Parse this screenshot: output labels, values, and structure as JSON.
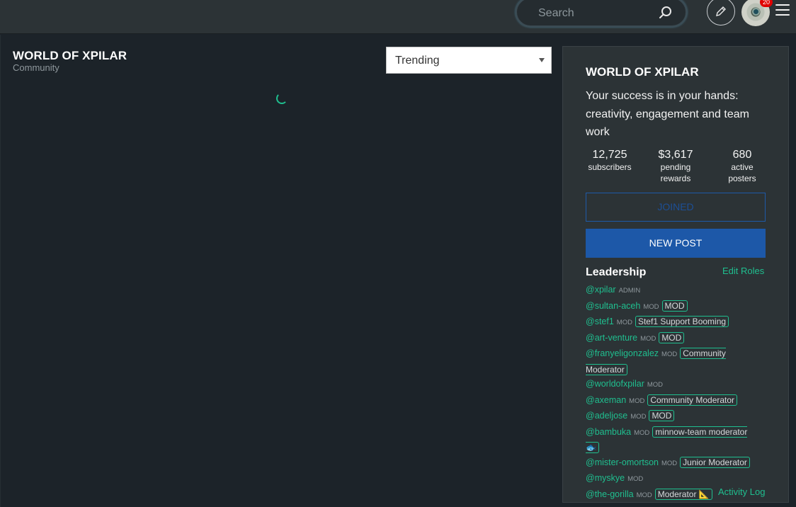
{
  "header": {
    "search": {
      "placeholder": "Search"
    },
    "notifications_badge": "20",
    "icons": [
      "search-icon",
      "pencil-icon",
      "avatar",
      "menu-icon"
    ]
  },
  "main": {
    "title": "WORLD OF XPILAR",
    "subtitle": "Community",
    "sort": {
      "selected": "Trending"
    }
  },
  "sidebar": {
    "title": "WORLD OF XPILAR",
    "description": "Your success is in your hands: creativity, engagement and team work",
    "stats": [
      {
        "value": "12,725",
        "label": "subscribers"
      },
      {
        "value": "$3,617",
        "label": "pending rewards"
      },
      {
        "value": "680",
        "label": "active posters"
      }
    ],
    "joined_label": "JOINED",
    "new_post_label": "NEW POST",
    "leadership_title": "Leadership",
    "edit_roles_label": "Edit Roles",
    "activity_log_label": "Activity Log",
    "leaders": [
      {
        "user": "@xpilar",
        "role": "ADMIN",
        "tag": ""
      },
      {
        "user": "@sultan-aceh",
        "role": "MOD",
        "tag": "MOD"
      },
      {
        "user": "@stef1",
        "role": "MOD",
        "tag": "Stef1 Support Booming"
      },
      {
        "user": "@art-venture",
        "role": "MOD",
        "tag": "MOD"
      },
      {
        "user": "@franyeligonzalez",
        "role": "MOD",
        "tag": "Community Moderator"
      },
      {
        "user": "@worldofxpilar",
        "role": "MOD",
        "tag": ""
      },
      {
        "user": "@axeman",
        "role": "MOD",
        "tag": "Community Moderator"
      },
      {
        "user": "@adeljose",
        "role": "MOD",
        "tag": "MOD"
      },
      {
        "user": "@bambuka",
        "role": "MOD",
        "tag": "minnow-team moderator 🐟"
      },
      {
        "user": "@mister-omortson",
        "role": "MOD",
        "tag": "Junior Moderator"
      },
      {
        "user": "@myskye",
        "role": "MOD",
        "tag": ""
      },
      {
        "user": "@the-gorilla",
        "role": "MOD",
        "tag": "Moderator 📐"
      }
    ]
  },
  "colors": {
    "accent": "#1fbf8f",
    "primary_button": "#1d58a8",
    "background": "#1c2329",
    "panel": "#2c3336"
  }
}
